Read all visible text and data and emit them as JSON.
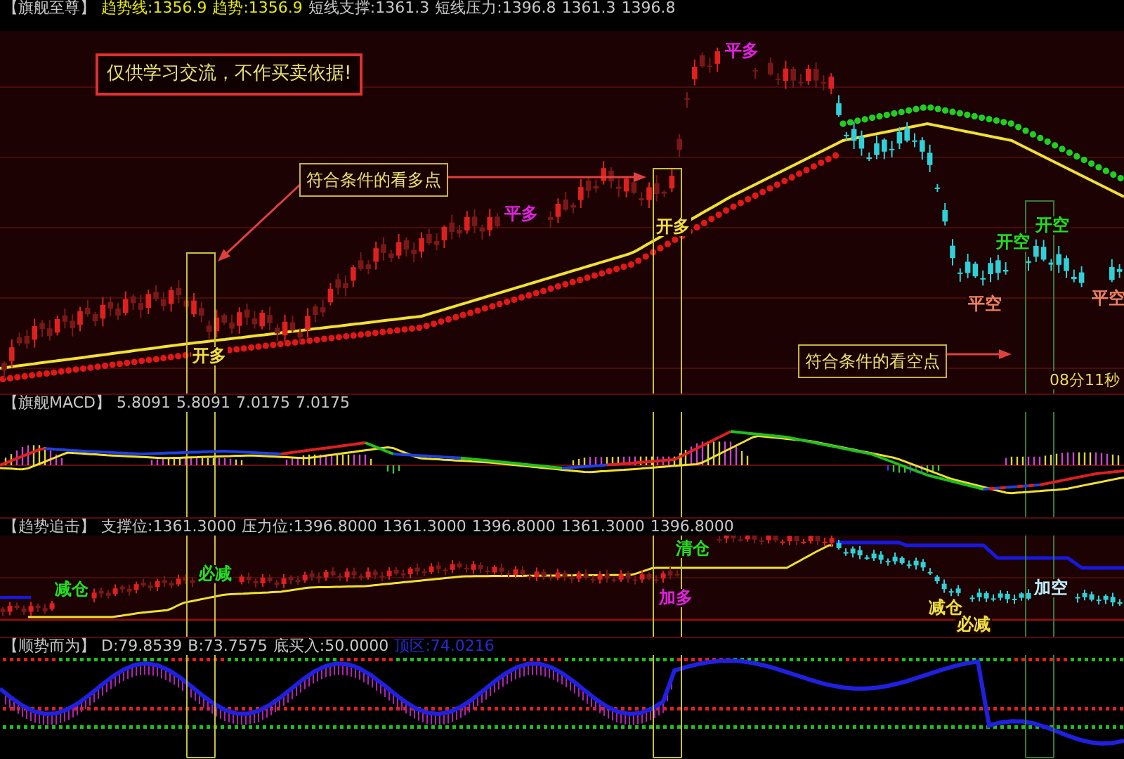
{
  "panels": [
    {
      "kind": "main",
      "title": "【旗舰至尊】",
      "readings": [
        {
          "text": "趋势线:1356.9",
          "color": "#e8e800"
        },
        {
          "text": "趋势:1356.9",
          "color": "#e8e800"
        },
        {
          "text": "短线支撑:1361.3",
          "color": "#c8c8c8"
        },
        {
          "text": "短线压力:1396.8",
          "color": "#c8c8c8"
        },
        {
          "text": "1361.3",
          "color": "#c8c8c8"
        },
        {
          "text": "1396.8",
          "color": "#c8c8c8"
        }
      ],
      "notice": "仅供学习交流，不作买卖依据!",
      "callouts": [
        {
          "text": "符合条件的看多点"
        },
        {
          "text": "符合条件的看空点"
        }
      ],
      "signals": [
        {
          "text": "开多",
          "color": "#f0e040"
        },
        {
          "text": "平多",
          "color": "#e020e0"
        },
        {
          "text": "开多",
          "color": "#f0e040"
        },
        {
          "text": "平多",
          "color": "#e020e0"
        },
        {
          "text": "开空",
          "color": "#20e020"
        },
        {
          "text": "开空",
          "color": "#20e020"
        },
        {
          "text": "平空",
          "color": "#f08060"
        },
        {
          "text": "平空",
          "color": "#f08060"
        }
      ],
      "timer": "08分11秒"
    },
    {
      "kind": "macd",
      "title": "【旗舰MACD】",
      "readings": [
        {
          "text": "5.8091",
          "color": "#c8c8c8"
        },
        {
          "text": "5.8091",
          "color": "#c8c8c8"
        },
        {
          "text": "7.0175",
          "color": "#c8c8c8"
        },
        {
          "text": "7.0175",
          "color": "#c8c8c8"
        }
      ]
    },
    {
      "kind": "trend",
      "title": "【趋势追击】",
      "readings": [
        {
          "text": "支撑位:1361.3000",
          "color": "#c8c8c8"
        },
        {
          "text": "压力位:1396.8000",
          "color": "#c8c8c8"
        },
        {
          "text": "1361.3000",
          "color": "#c8c8c8"
        },
        {
          "text": "1396.8000",
          "color": "#c8c8c8"
        },
        {
          "text": "1361.3000",
          "color": "#c8c8c8"
        },
        {
          "text": "1396.8000",
          "color": "#c8c8c8"
        }
      ],
      "signals": [
        {
          "text": "减仓",
          "color": "#20e020"
        },
        {
          "text": "必减",
          "color": "#20e020"
        },
        {
          "text": "清仓",
          "color": "#20e020"
        },
        {
          "text": "加多",
          "color": "#e020e0"
        },
        {
          "text": "减仓",
          "color": "#f0e040"
        },
        {
          "text": "必减",
          "color": "#f0e040"
        },
        {
          "text": "加空",
          "color": "#c0f0ff"
        }
      ]
    },
    {
      "kind": "momentum",
      "title": "【顺势而为】",
      "readings": [
        {
          "text": "D:79.8539",
          "color": "#c8c8c8"
        },
        {
          "text": "B:73.7575",
          "color": "#c8c8c8"
        },
        {
          "text": "底买入:50.0000",
          "color": "#c8c8c8"
        },
        {
          "text": "顶区:74.0216",
          "color": "#2a2ad0"
        }
      ]
    }
  ]
}
